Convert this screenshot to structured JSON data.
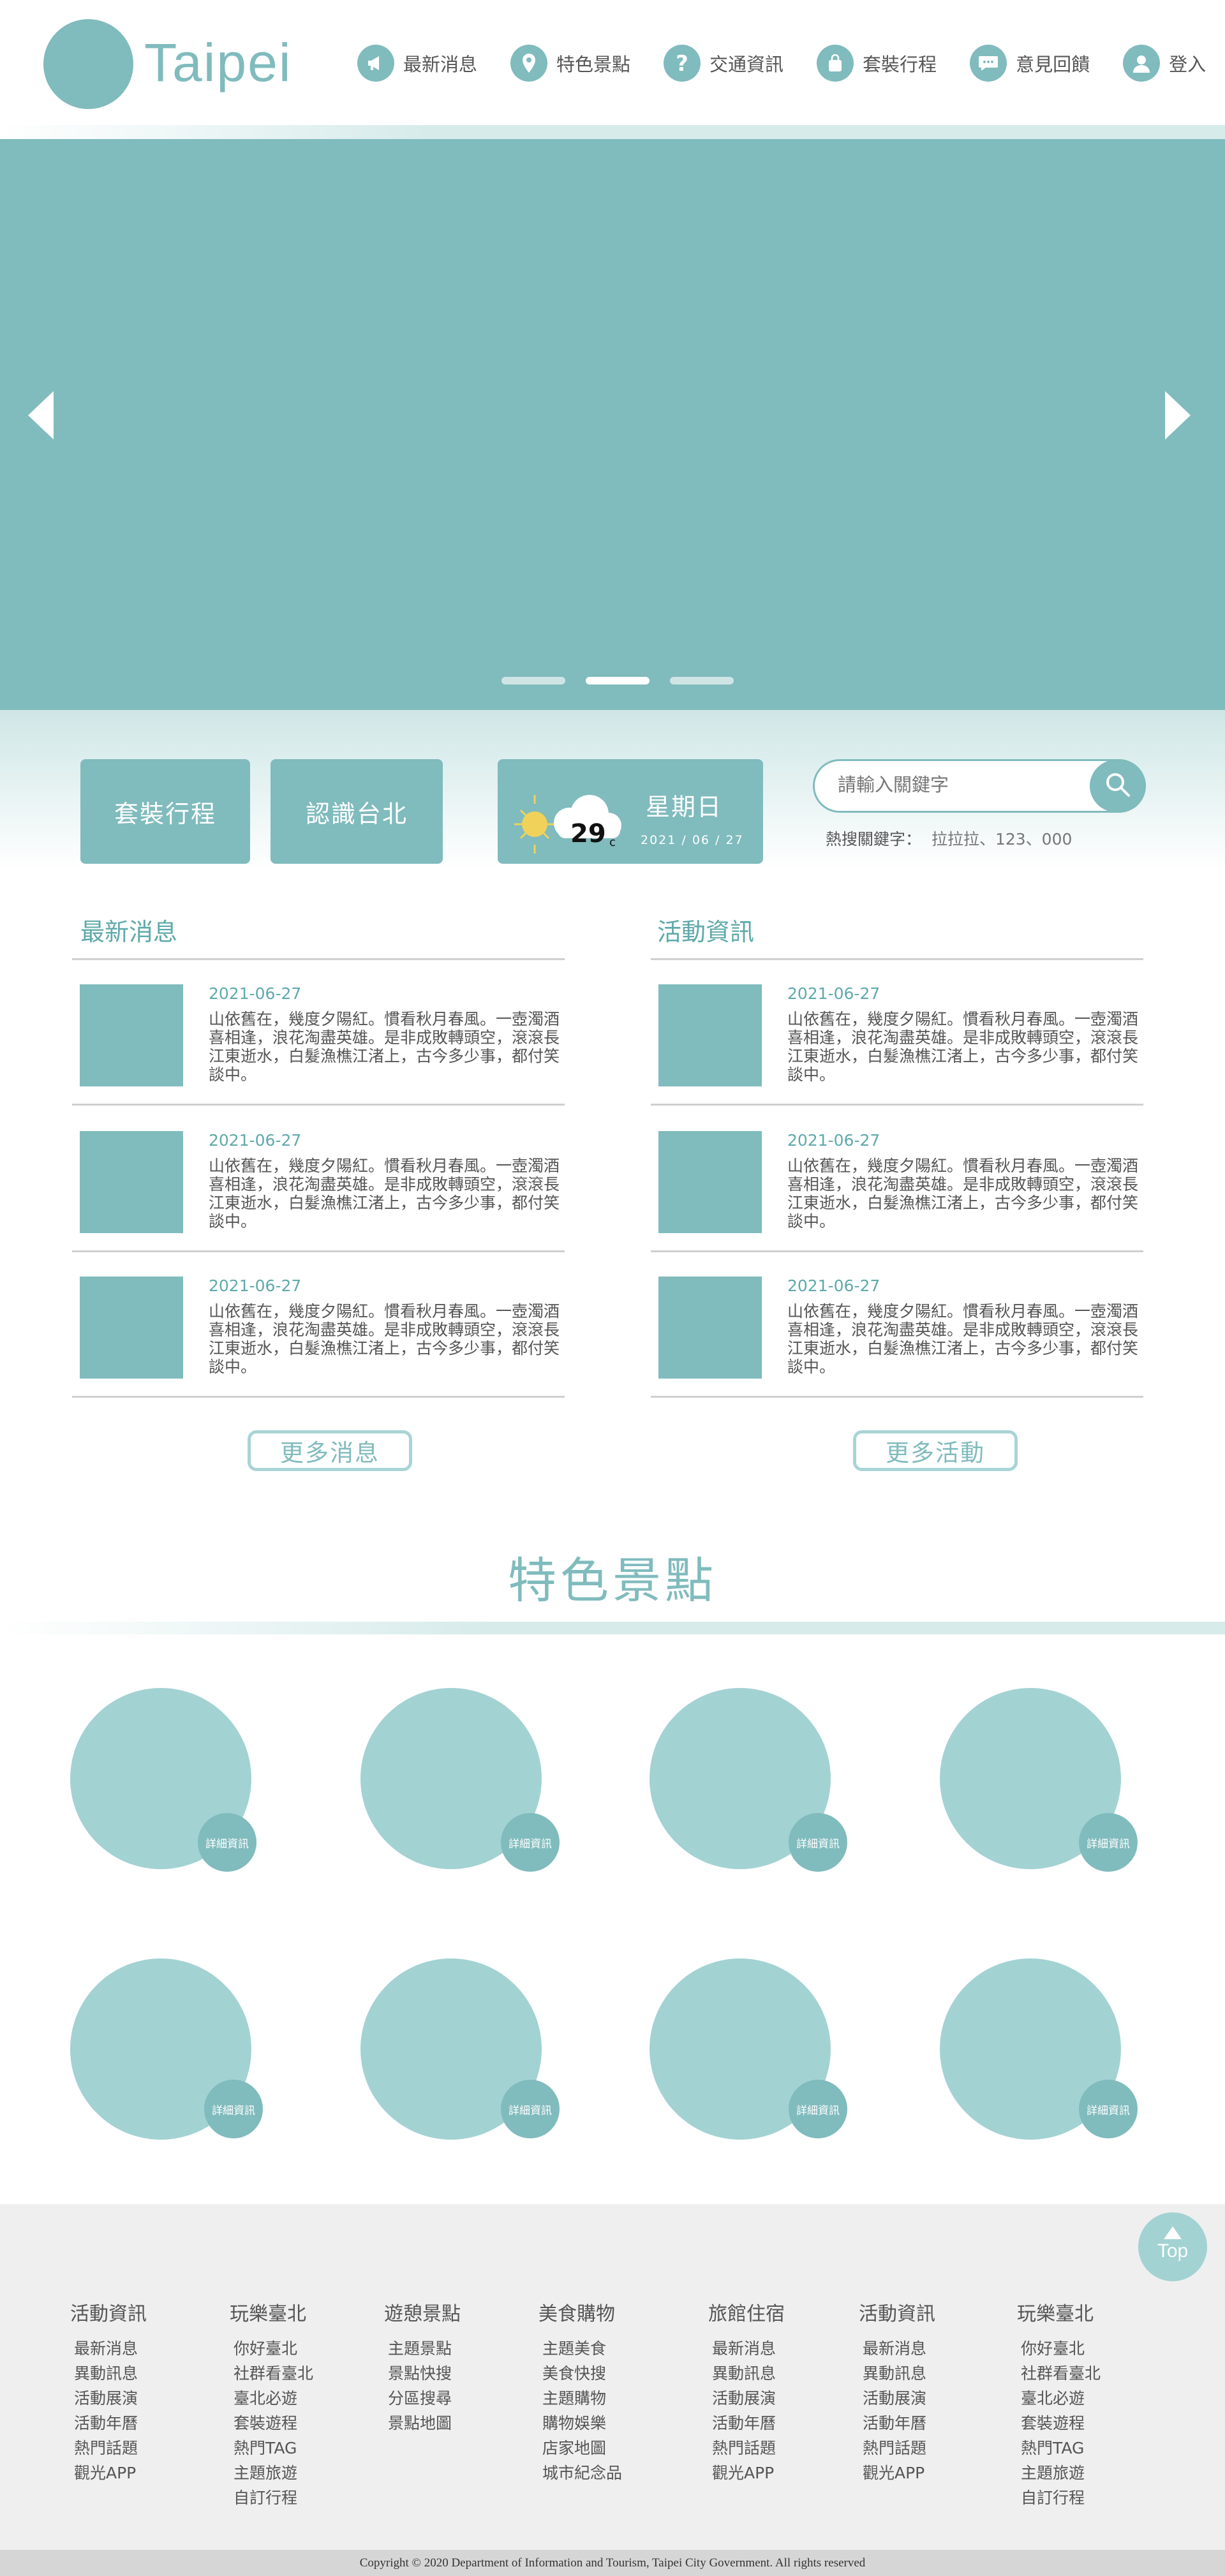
{
  "header": {
    "logo_text": "Taipei",
    "nav": [
      {
        "label": "最新消息",
        "icon": "megaphone-icon"
      },
      {
        "label": "特色景點",
        "icon": "map-pin-icon"
      },
      {
        "label": "交通資訊",
        "icon": "question-icon"
      },
      {
        "label": "套裝行程",
        "icon": "bag-icon"
      },
      {
        "label": "意見回饋",
        "icon": "chat-icon"
      },
      {
        "label": "登入",
        "icon": "user-icon"
      }
    ]
  },
  "hero": {
    "prev_icon": "chevron-left-icon",
    "next_icon": "chevron-right-icon",
    "slides": 3,
    "active_slide": 2
  },
  "quick": {
    "package_label": "套裝行程",
    "about_label": "認識台北",
    "weather": {
      "icon": "sun-cloud-icon",
      "temp": "29",
      "unit": "c",
      "weekday": "星期日",
      "date": "2021 / 06 / 27"
    },
    "search": {
      "placeholder": "請輸入關鍵字",
      "icon": "search-icon"
    },
    "hot": {
      "label": "熱搜關鍵字：",
      "keywords": "拉拉拉、123、000"
    }
  },
  "news": {
    "title": "最新消息",
    "more_label": "更多消息",
    "items": [
      {
        "date": "2021-06-27",
        "text": "山依舊在，幾度夕陽紅。慣看秋月春風。一壺濁酒喜相逢，浪花淘盡英雄。是非成敗轉頭空，滾滾長江東逝水，白髮漁樵江渚上，古今多少事，都付笑談中。"
      },
      {
        "date": "2021-06-27",
        "text": "山依舊在，幾度夕陽紅。慣看秋月春風。一壺濁酒喜相逢，浪花淘盡英雄。是非成敗轉頭空，滾滾長江東逝水，白髮漁樵江渚上，古今多少事，都付笑談中。"
      },
      {
        "date": "2021-06-27",
        "text": "山依舊在，幾度夕陽紅。慣看秋月春風。一壺濁酒喜相逢，浪花淘盡英雄。是非成敗轉頭空，滾滾長江東逝水，白髮漁樵江渚上，古今多少事，都付笑談中。"
      }
    ]
  },
  "events": {
    "title": "活動資訊",
    "more_label": "更多活動",
    "items": [
      {
        "date": "2021-06-27",
        "text": "山依舊在，幾度夕陽紅。慣看秋月春風。一壺濁酒喜相逢，浪花淘盡英雄。是非成敗轉頭空，滾滾長江東逝水，白髮漁樵江渚上，古今多少事，都付笑談中。"
      },
      {
        "date": "2021-06-27",
        "text": "山依舊在，幾度夕陽紅。慣看秋月春風。一壺濁酒喜相逢，浪花淘盡英雄。是非成敗轉頭空，滾滾長江東逝水，白髮漁樵江渚上，古今多少事，都付笑談中。"
      },
      {
        "date": "2021-06-27",
        "text": "山依舊在，幾度夕陽紅。慣看秋月春風。一壺濁酒喜相逢，浪花淘盡英雄。是非成敗轉頭空，滾滾長江東逝水，白髮漁樵江渚上，古今多少事，都付笑談中。"
      }
    ]
  },
  "attractions": {
    "title": "特色景點",
    "detail_label": "詳細資訊",
    "count": 8
  },
  "footer": {
    "top_label": "Top",
    "top_icon": "arrow-up-icon",
    "columns": [
      {
        "head": "活動資訊",
        "links": [
          "最新消息",
          "異動訊息",
          "活動展演",
          "活動年曆",
          "熱門話題",
          "觀光APP"
        ]
      },
      {
        "head": "玩樂臺北",
        "links": [
          "你好臺北",
          "社群看臺北",
          "臺北必遊",
          "套裝遊程",
          "熱門TAG",
          "主題旅遊",
          "自訂行程"
        ]
      },
      {
        "head": "遊憩景點",
        "links": [
          "主題景點",
          "景點快搜",
          "分區搜尋",
          "景點地圖"
        ]
      },
      {
        "head": "美食購物",
        "links": [
          "主題美食",
          "美食快搜",
          "主題購物",
          "購物娛樂",
          "店家地圖",
          "城市紀念品"
        ]
      },
      {
        "head": "旅館住宿",
        "links": [
          "最新消息",
          "異動訊息",
          "活動展演",
          "活動年曆",
          "熱門話題",
          "觀光APP"
        ]
      },
      {
        "head": "活動資訊",
        "links": [
          "最新消息",
          "異動訊息",
          "活動展演",
          "活動年曆",
          "熱門話題",
          "觀光APP"
        ]
      },
      {
        "head": "玩樂臺北",
        "links": [
          "你好臺北",
          "社群看臺北",
          "臺北必遊",
          "套裝遊程",
          "熱門TAG",
          "主題旅遊",
          "自訂行程"
        ]
      }
    ],
    "copyright": "Copyright © 2020 Department of Information and Tourism, Taipei City Government. All rights reserved"
  },
  "colors": {
    "accent": "#80bbbd",
    "accent_light": "#a3d2d3",
    "title_text": "#5fa9ab",
    "footer_bg": "#efefef",
    "copyright_bg": "#d6d6d6"
  }
}
